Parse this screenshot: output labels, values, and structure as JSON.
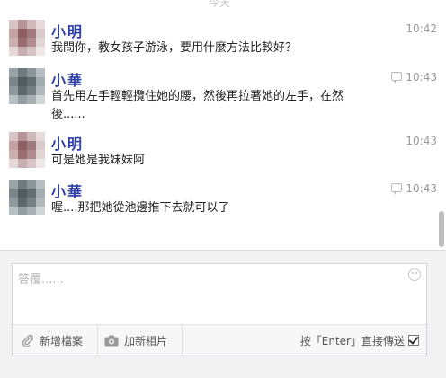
{
  "thread": {
    "top_label": "今天",
    "messages": [
      {
        "sender": "小明",
        "time": "10:42",
        "text": "我問你，教女孩子游泳，要用什麼方法比較好？",
        "has_reply_icon": false
      },
      {
        "sender": "小華",
        "time": "10:43",
        "text": "首先用左手輕輕攬住她的腰，然後再拉著她的左手，在然後......",
        "has_reply_icon": true
      },
      {
        "sender": "小明",
        "time": "10:43",
        "text": "可是她是我妹妹阿",
        "has_reply_icon": false
      },
      {
        "sender": "小華",
        "time": "10:43",
        "text": "喔....那把她從池邊推下去就可以了",
        "has_reply_icon": true
      }
    ]
  },
  "composer": {
    "placeholder": "答覆......",
    "attach_label": "新增檔案",
    "photo_label": "加新相片",
    "enter_send_label": "按「Enter」直接傳送",
    "enter_send_checked": true
  },
  "colors": {
    "sender_name": "#2d3ea4",
    "timestamp": "#9a9a9a",
    "composer_bg": "#f2f2f2"
  },
  "icons": {
    "attach": "paperclip-icon",
    "photo": "camera-icon",
    "emoji": "smiley-icon",
    "reply": "reply-bubble-icon"
  }
}
